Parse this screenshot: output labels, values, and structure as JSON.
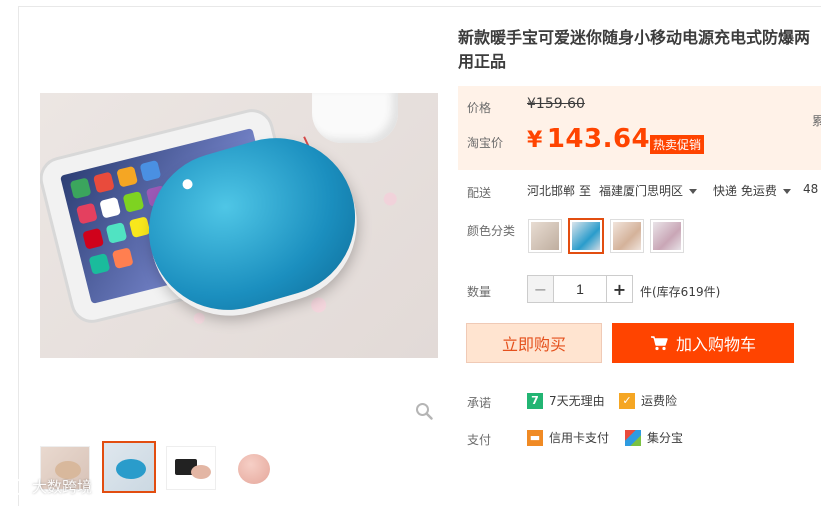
{
  "product": {
    "title": "新款暖手宝可爱迷你随身小移动电源充电式防爆两用正品"
  },
  "price": {
    "price_label": "价格",
    "original": "¥159.60",
    "taobao_label": "淘宝价",
    "currency": "¥",
    "current": "143.64",
    "promo_badge": "热卖促销",
    "clipped_text": "累"
  },
  "shipping": {
    "label": "配送",
    "from": "河北邯郸",
    "to_word": "至",
    "destination": "福建厦门思明区",
    "method": "快递 免运费",
    "clipped": "48"
  },
  "color": {
    "label": "颜色分类",
    "selected_index": 1
  },
  "quantity": {
    "label": "数量",
    "minus": "−",
    "value": "1",
    "plus": "+",
    "stock": "件(库存619件)"
  },
  "actions": {
    "buy_now": "立即购买",
    "add_cart": "加入购物车"
  },
  "services": {
    "promise_label": "承诺",
    "promise_1": "7天无理由",
    "promise_2": "运费险",
    "pay_label": "支付",
    "pay_1": "信用卡支付",
    "pay_2": "集分宝"
  },
  "watermark": {
    "text": "大数跨境"
  },
  "colors": {
    "accent": "#ff4400",
    "price": "#ff4400",
    "price_bg": "#fff2e8",
    "buy_now_bg": "#ffe4d0",
    "selected_border": "#e24d10"
  },
  "icons": [
    "zoom-icon",
    "cart-icon",
    "seven-day-icon",
    "freight-insurance-icon",
    "credit-card-icon",
    "jifenbao-icon"
  ]
}
